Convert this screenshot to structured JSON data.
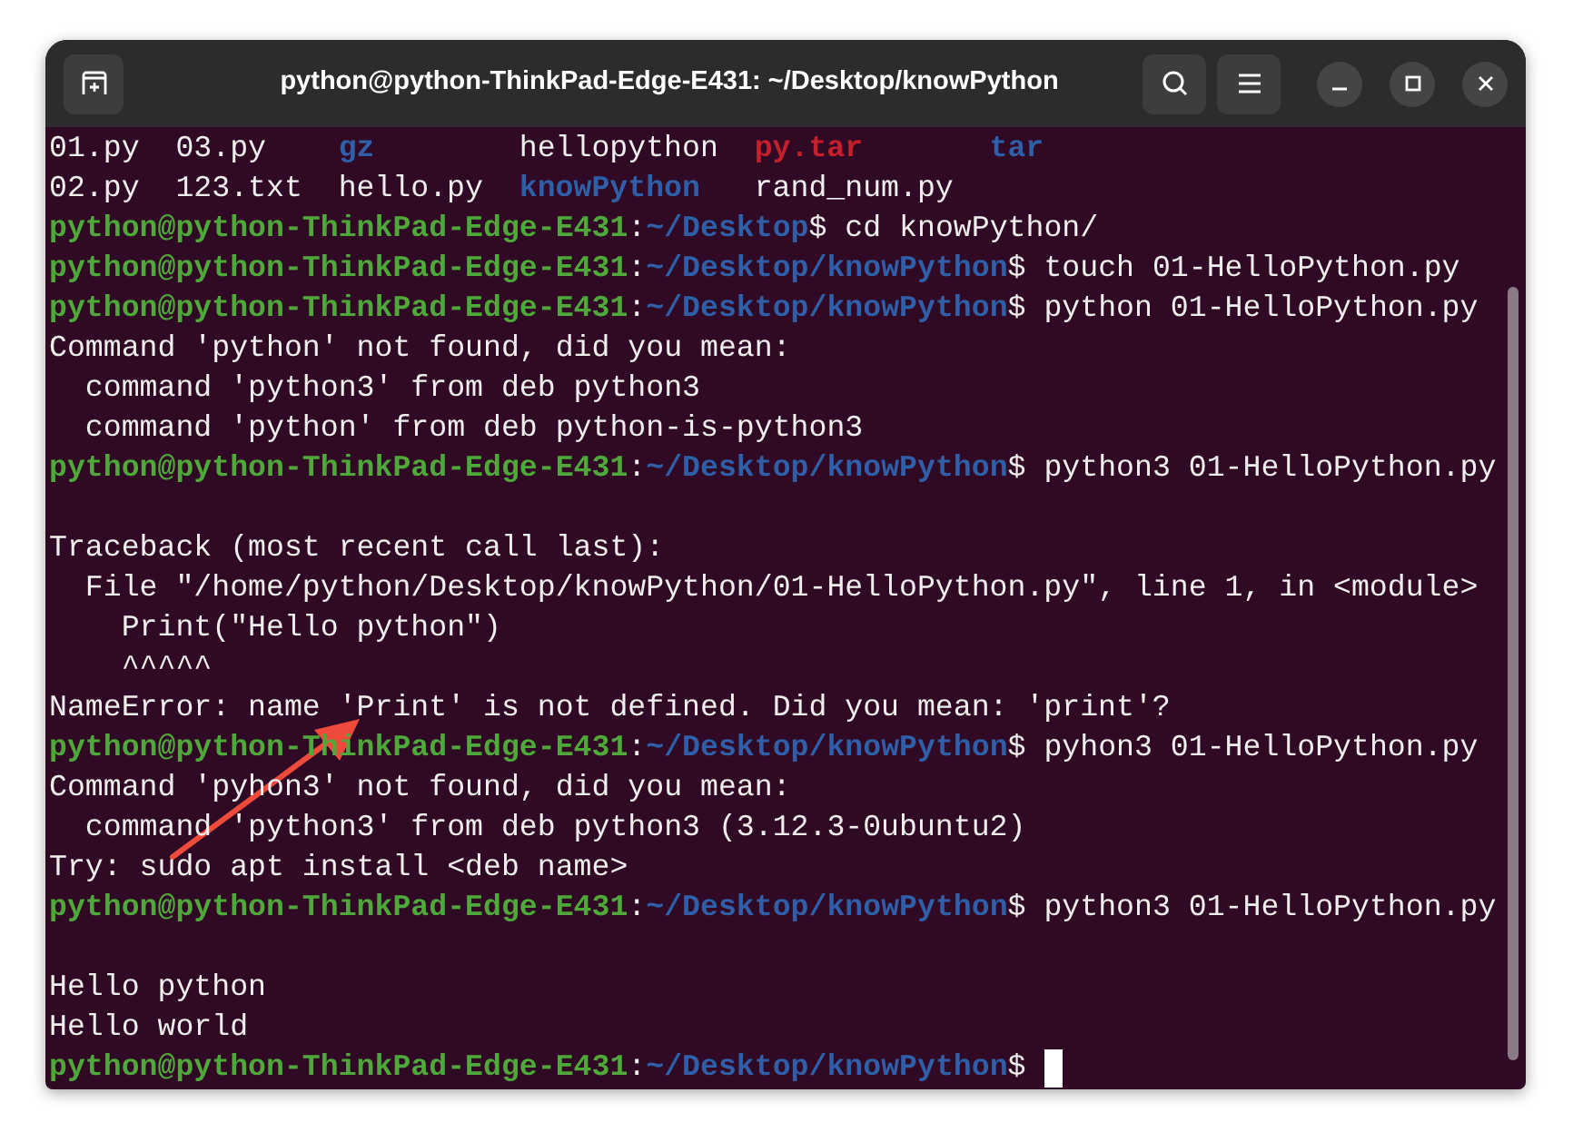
{
  "window": {
    "title": "python@python-ThinkPad-Edge-E431: ~/Desktop/knowPython"
  },
  "ls_rows": [
    [
      {
        "text": "01.py",
        "kind": "file"
      },
      {
        "text": "03.py",
        "kind": "file"
      },
      {
        "text": "gz",
        "kind": "dir"
      },
      {
        "text": "hellopython",
        "kind": "file"
      },
      {
        "text": "py.tar",
        "kind": "archive"
      },
      {
        "text": "tar",
        "kind": "dir"
      }
    ],
    [
      {
        "text": "02.py",
        "kind": "file"
      },
      {
        "text": "123.txt",
        "kind": "file"
      },
      {
        "text": "hello.py",
        "kind": "file"
      },
      {
        "text": "knowPython",
        "kind": "dir"
      },
      {
        "text": "rand_num.py",
        "kind": "file"
      }
    ]
  ],
  "lines": [
    {
      "kind": "prompt",
      "user": "python@python-ThinkPad-Edge-E431",
      "separator": ":",
      "path": "~/Desktop",
      "command": "$ cd knowPython/"
    },
    {
      "kind": "prompt",
      "user": "python@python-ThinkPad-Edge-E431",
      "separator": ":",
      "path": "~/Desktop/knowPython",
      "command": "$ touch 01-HelloPython.py"
    },
    {
      "kind": "prompt",
      "user": "python@python-ThinkPad-Edge-E431",
      "separator": ":",
      "path": "~/Desktop/knowPython",
      "command": "$ python 01-HelloPython.py"
    },
    {
      "kind": "output",
      "text": "Command 'python' not found, did you mean:"
    },
    {
      "kind": "output",
      "text": "  command 'python3' from deb python3"
    },
    {
      "kind": "output",
      "text": "  command 'python' from deb python-is-python3"
    },
    {
      "kind": "prompt",
      "user": "python@python-ThinkPad-Edge-E431",
      "separator": ":",
      "path": "~/Desktop/knowPython",
      "command": "$ python3 01-HelloPython.py"
    },
    {
      "kind": "blank"
    },
    {
      "kind": "output",
      "text": "Traceback (most recent call last):"
    },
    {
      "kind": "output",
      "text": "  File \"/home/python/Desktop/knowPython/01-HelloPython.py\", line 1, in <module>"
    },
    {
      "kind": "output",
      "text": "    Print(\"Hello python\")"
    },
    {
      "kind": "output",
      "text": "    ^^^^^"
    },
    {
      "kind": "output",
      "text": "NameError: name 'Print' is not defined. Did you mean: 'print'?"
    },
    {
      "kind": "prompt",
      "user": "python@python-ThinkPad-Edge-E431",
      "separator": ":",
      "path": "~/Desktop/knowPython",
      "command": "$ pyhon3 01-HelloPython.py"
    },
    {
      "kind": "output",
      "text": "Command 'pyhon3' not found, did you mean:"
    },
    {
      "kind": "output",
      "text": "  command 'python3' from deb python3 (3.12.3-0ubuntu2)"
    },
    {
      "kind": "output",
      "text": "Try: sudo apt install <deb name>"
    },
    {
      "kind": "prompt",
      "user": "python@python-ThinkPad-Edge-E431",
      "separator": ":",
      "path": "~/Desktop/knowPython",
      "command": "$ python3 01-HelloPython.py"
    },
    {
      "kind": "blank"
    },
    {
      "kind": "output",
      "text": "Hello python"
    },
    {
      "kind": "output",
      "text": "Hello world"
    },
    {
      "kind": "prompt",
      "user": "python@python-ThinkPad-Edge-E431",
      "separator": ":",
      "path": "~/Desktop/knowPython",
      "command": "$",
      "cursor": true
    }
  ]
}
